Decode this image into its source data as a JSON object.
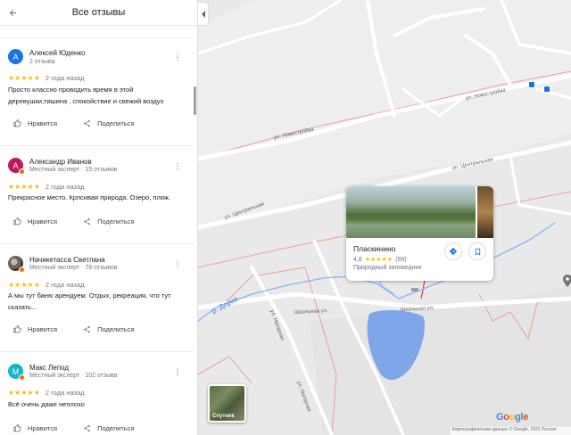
{
  "panel": {
    "title": "Все отзывы",
    "actions": {
      "like": "Нравится",
      "share": "Поделиться"
    }
  },
  "reviews": [
    {
      "initial": "А",
      "avatar_color": "#1a73e8",
      "name": "Алексей Юденко",
      "meta": "2 отзыва",
      "stars": "★★★★★",
      "date": "2 года назад",
      "text_lines": [
        "Просто классно проводить время в этой",
        "деревушки,тишина , спокойствие и свежий воздух"
      ]
    },
    {
      "initial": "А",
      "avatar_color": "#c2185b",
      "name": "Александр Иванов",
      "meta": "Местный эксперт · 15 отзывов",
      "stars": "★★★★★",
      "date": "2 года назад",
      "text_lines": [
        "Прекрасное место. Крпсивая природа. Озеро, пляж."
      ]
    },
    {
      "initial": "",
      "avatar_color": "#6d6259",
      "name": "Начикетасса Светлана",
      "meta": "Местный эксперт · 78 отзывов",
      "stars": "★★★★★",
      "date": "2 года назад",
      "text_lines": [
        "А мы тут баню арендуем. Отдых, рекреация, что тут",
        "сказать..."
      ]
    },
    {
      "initial": "М",
      "avatar_color": "#12b5cb",
      "name": "Макс Лепод",
      "meta": "Местный эксперт · 102 отзыва",
      "stars": "★★★★★",
      "date": "2 года назад",
      "text_lines": [
        "Всё очень даже неплохо"
      ]
    }
  ],
  "map": {
    "streets": {
      "novostroyka": "ул. Новостройка",
      "tsentralnaya": "ул. Центральная",
      "tsentralnaya_short": "ул. Центральная",
      "shkolnaya": "Школьная ул.",
      "shkolnaya_short": "Школьная ул.",
      "nagornaya": "ул. Нагорная",
      "nagornaya_lower": "ул. Нагорная"
    },
    "river": "р. Дорка",
    "place_card": {
      "name": "Пласкинино",
      "rating": "4,8",
      "stars": "★★★★★",
      "count": "(69)",
      "type": "Природный заповедник"
    },
    "satellite_label": "Спутник",
    "logo": "Google",
    "attribution": "Картографические данные © Google, 2021   Россия"
  }
}
